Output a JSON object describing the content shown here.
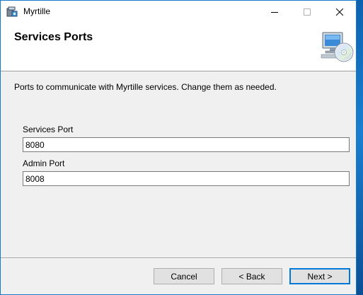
{
  "window": {
    "title": "Myrtille"
  },
  "titlebar_buttons": {
    "minimize": "—",
    "maximize": "☐",
    "close": "✕"
  },
  "header": {
    "title": "Services Ports"
  },
  "description": "Ports to communicate with Myrtille services. Change them as needed.",
  "fields": {
    "services_port": {
      "label": "Services Port",
      "value": "8080"
    },
    "admin_port": {
      "label": "Admin Port",
      "value": "8008"
    }
  },
  "buttons": {
    "cancel": "Cancel",
    "back": "< Back",
    "next": "Next >"
  },
  "icons": {
    "app": "installer-icon",
    "header": "computer-disc-icon"
  },
  "colors": {
    "accent": "#0078d7",
    "window_border": "#1979ca"
  }
}
